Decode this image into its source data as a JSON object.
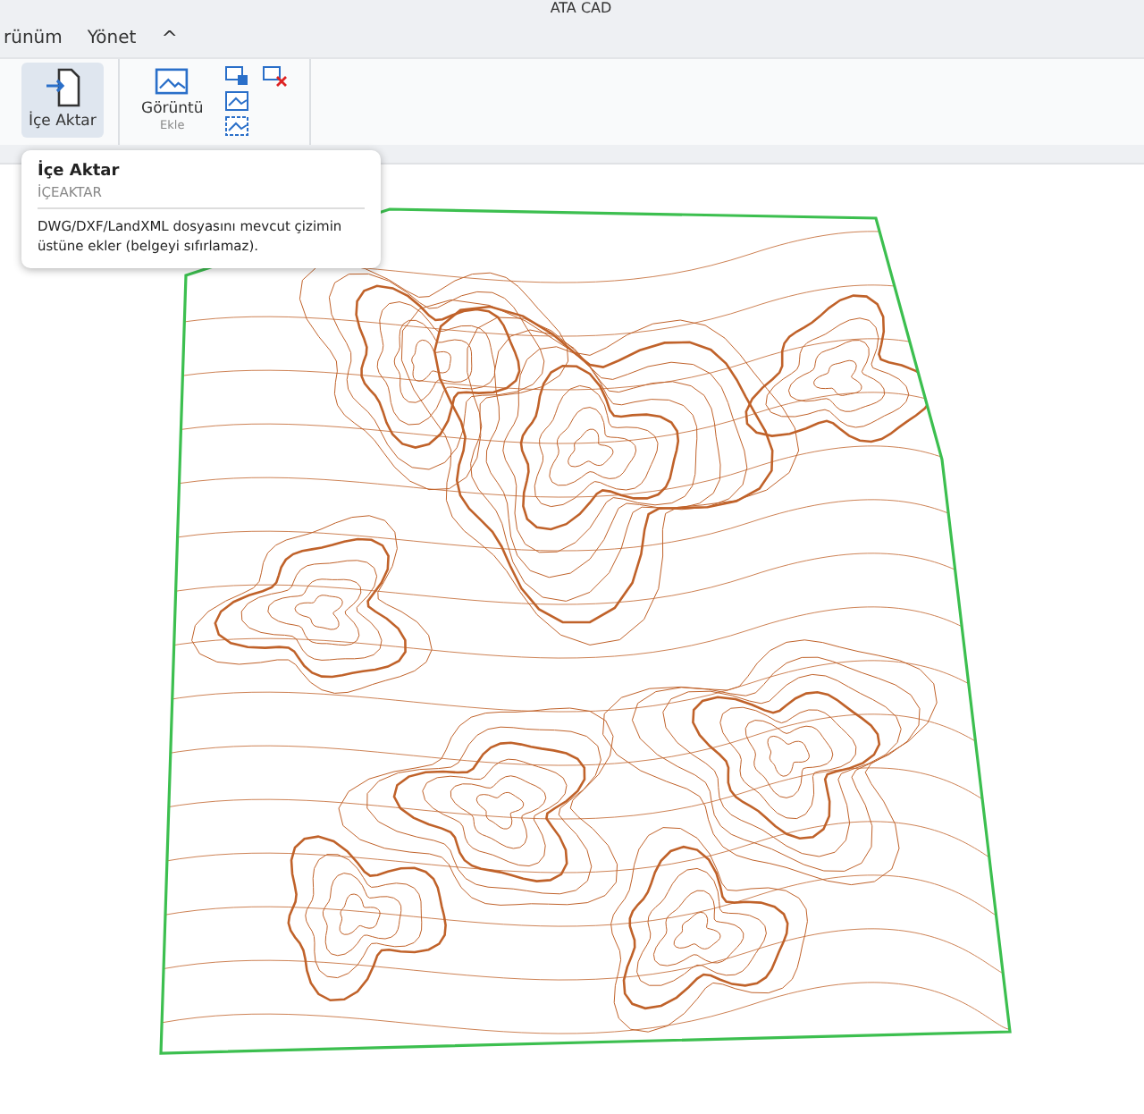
{
  "window": {
    "title": "ATA CAD"
  },
  "tabs": [
    {
      "label": "rünüm",
      "selected": false
    },
    {
      "label": "Yönet",
      "selected": false
    }
  ],
  "ribbon": {
    "collapse_glyph": "^",
    "buttons": [
      {
        "kind": "large",
        "label": "İçe Aktar",
        "selected": true
      },
      {
        "kind": "large",
        "label": "Görüntü",
        "sublabel": "Ekle",
        "selected": false
      }
    ]
  },
  "tooltip": {
    "title": "İçe Aktar",
    "command": "İÇEAKTAR",
    "description": "DWG/DXF/LandXML dosyasını mevcut çizimin üstüne ekler (belgeyi sıfırlamaz)."
  }
}
